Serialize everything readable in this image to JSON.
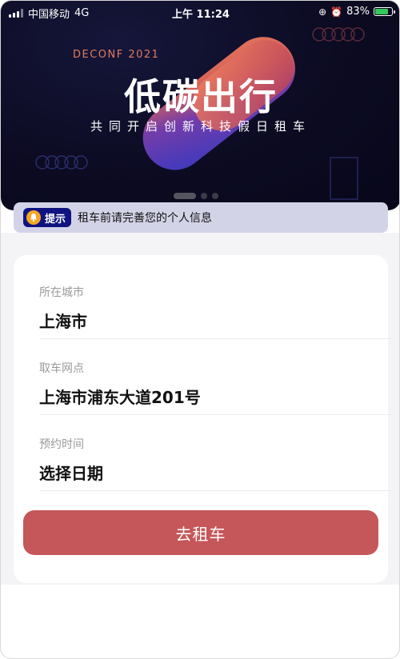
{
  "status_bar": {
    "carrier": "中国移动",
    "network": "4G",
    "time": "上午 11:24",
    "battery": "83%",
    "battery_level": 0.83
  },
  "banner": {
    "small_text": "DECONF 2021",
    "title": "低碳出行",
    "subtitle": "共同开启创新科技假日租车",
    "page_count": 3,
    "active_page": 0
  },
  "notice": {
    "badge_label": "提示",
    "text": "租车前请完善您的个人信息"
  },
  "form": {
    "city": {
      "label": "所在城市",
      "value": "上海市"
    },
    "pickup": {
      "label": "取车网点",
      "value": "上海市浦东大道201号"
    },
    "time": {
      "label": "预约时间",
      "value": "选择日期"
    },
    "submit_label": "去租车"
  },
  "colors": {
    "accent_button": "#c5575a",
    "notice_bg": "#d3d3e8",
    "notice_badge": "#0e1380",
    "banner_bg": "#0c0b22"
  }
}
